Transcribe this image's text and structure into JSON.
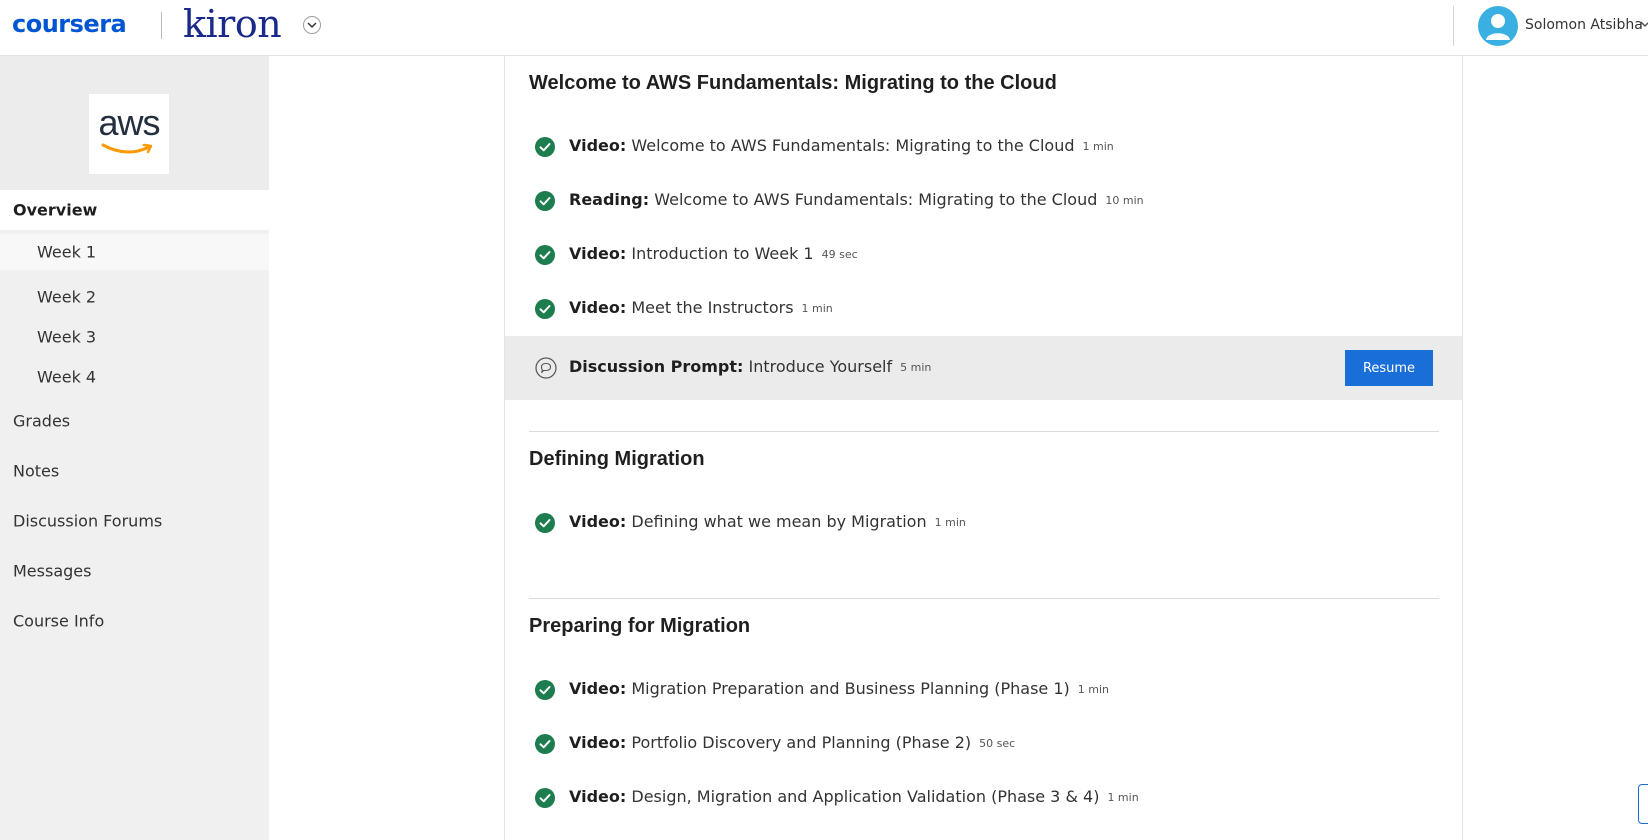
{
  "header": {
    "brand": "coursera",
    "partner": "kiron",
    "user_name": "Solomon Atsibha"
  },
  "sidebar": {
    "course_logo_text": "aws",
    "overview_label": "Overview",
    "weeks": [
      "Week 1",
      "Week 2",
      "Week 3",
      "Week 4"
    ],
    "links": [
      "Grades",
      "Notes",
      "Discussion Forums",
      "Messages",
      "Course Info"
    ]
  },
  "sections": [
    {
      "title": "Welcome to AWS Fundamentals: Migrating to the Cloud",
      "items": [
        {
          "type": "Video:",
          "title": "Welcome to AWS Fundamentals: Migrating to the Cloud",
          "duration": "1 min",
          "status": "completed"
        },
        {
          "type": "Reading:",
          "title": "Welcome to AWS Fundamentals: Migrating to the Cloud",
          "duration": "10 min",
          "status": "completed"
        },
        {
          "type": "Video:",
          "title": "Introduction to Week 1",
          "duration": "49 sec",
          "status": "completed"
        },
        {
          "type": "Video:",
          "title": "Meet the Instructors",
          "duration": "1 min",
          "status": "completed"
        },
        {
          "type": "Discussion Prompt:",
          "title": "Introduce Yourself",
          "duration": "5 min",
          "status": "in-progress",
          "action": "Resume"
        }
      ]
    },
    {
      "title": "Defining Migration",
      "items": [
        {
          "type": "Video:",
          "title": "Defining what we mean by Migration",
          "duration": "1 min",
          "status": "completed"
        }
      ]
    },
    {
      "title": "Preparing for Migration",
      "items": [
        {
          "type": "Video:",
          "title": "Migration Preparation and Business Planning (Phase 1)",
          "duration": "1 min",
          "status": "completed"
        },
        {
          "type": "Video:",
          "title": "Portfolio Discovery and Planning (Phase 2)",
          "duration": "50 sec",
          "status": "completed"
        },
        {
          "type": "Video:",
          "title": "Design, Migration and Application Validation (Phase 3 & 4)",
          "duration": "1 min",
          "status": "completed"
        }
      ]
    }
  ],
  "colors": {
    "accent": "#1a6ed8",
    "check_green": "#1e7d4e",
    "sidebar_bg": "#f0f0f0",
    "highlight_row": "#ebebeb"
  }
}
